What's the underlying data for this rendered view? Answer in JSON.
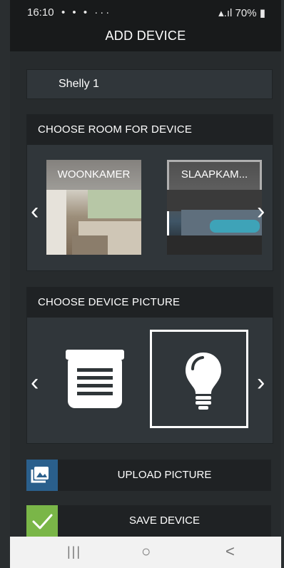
{
  "status": {
    "time": "16:10",
    "icons": "• • • ···",
    "battery": "70%"
  },
  "header": {
    "title": "ADD DEVICE"
  },
  "device_name": {
    "value": "Shelly 1"
  },
  "rooms": {
    "heading": "CHOOSE ROOM FOR DEVICE",
    "items": [
      {
        "label": "WOONKAMER"
      },
      {
        "label": "SLAAPKAM..."
      }
    ]
  },
  "pictures": {
    "heading": "CHOOSE DEVICE PICTURE",
    "items": [
      {
        "icon": "blinds-icon"
      },
      {
        "icon": "light-bulb-icon"
      }
    ]
  },
  "actions": {
    "upload_label": "UPLOAD PICTURE",
    "save_label": "SAVE DEVICE",
    "upload_color": "#2a5f8c",
    "save_color": "#7ab648"
  },
  "navbar": {
    "recent": "|||",
    "home": "○",
    "back": "<"
  }
}
